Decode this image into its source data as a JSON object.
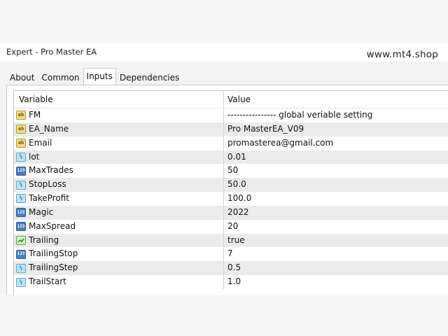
{
  "window": {
    "title": "Expert - Pro Master EA",
    "watermark": "www.mt4.shop"
  },
  "tabs": [
    {
      "label": "About"
    },
    {
      "label": "Common"
    },
    {
      "label": "Inputs",
      "active": true
    },
    {
      "label": "Dependencies"
    }
  ],
  "grid": {
    "columns": {
      "variable": "Variable",
      "value": "Value"
    },
    "rows": [
      {
        "icon": "string-type-icon",
        "variable": "FM",
        "value": "---------------- global veriable setting"
      },
      {
        "icon": "string-type-icon",
        "variable": "EA_Name",
        "value": "Pro MasterEA_V09"
      },
      {
        "icon": "string-type-icon",
        "variable": "Email",
        "value": "promasterea@gmail.com"
      },
      {
        "icon": "double-type-icon",
        "variable": "lot",
        "value": "0.01"
      },
      {
        "icon": "int-type-icon",
        "variable": "MaxTrades",
        "value": "50"
      },
      {
        "icon": "double-type-icon",
        "variable": "StopLoss",
        "value": "50.0"
      },
      {
        "icon": "double-type-icon",
        "variable": "TakeProfit",
        "value": "100.0"
      },
      {
        "icon": "int-type-icon",
        "variable": "Magic",
        "value": "2022"
      },
      {
        "icon": "int-type-icon",
        "variable": "MaxSpread",
        "value": "20"
      },
      {
        "icon": "bool-type-icon",
        "variable": "Trailing",
        "value": "true"
      },
      {
        "icon": "int-type-icon",
        "variable": "TrailingStop",
        "value": "7"
      },
      {
        "icon": "double-type-icon",
        "variable": "TrailingStep",
        "value": "0.5"
      },
      {
        "icon": "double-type-icon",
        "variable": "TrailStart",
        "value": "1.0"
      }
    ]
  },
  "icon_glyphs": {
    "string": "ab",
    "double": "½",
    "int": "123"
  },
  "colors": {
    "active_tab_bg": "#ffffff",
    "stripe": "#ebebeb"
  }
}
